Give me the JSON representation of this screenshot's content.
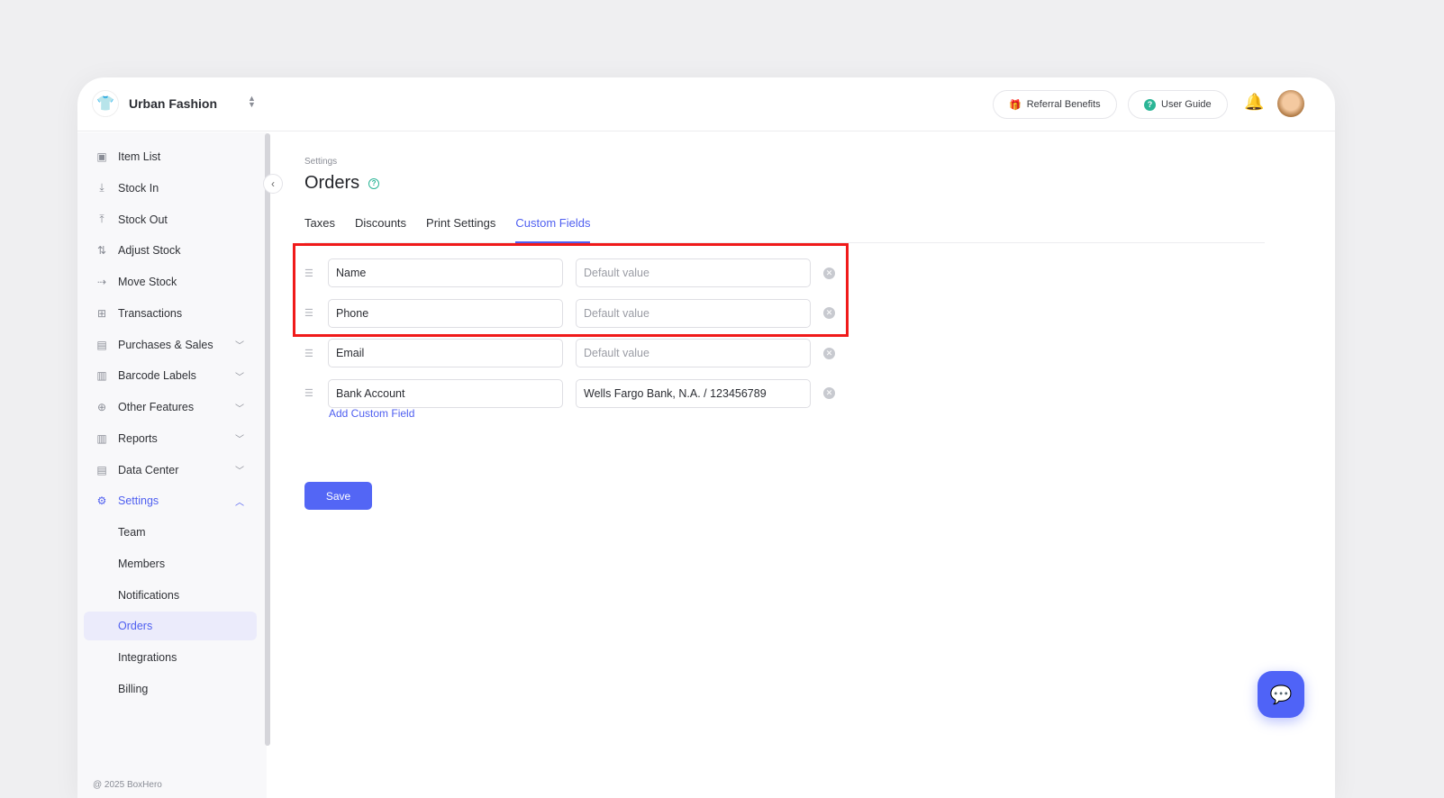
{
  "header": {
    "store_name": "Urban Fashion",
    "referral": "Referral Benefits",
    "user_guide": "User Guide"
  },
  "sidebar": {
    "items": [
      {
        "label": "Item List",
        "icon": "box-icon"
      },
      {
        "label": "Stock In",
        "icon": "arrow-down-icon"
      },
      {
        "label": "Stock Out",
        "icon": "arrow-up-icon"
      },
      {
        "label": "Adjust Stock",
        "icon": "arrows-updown-icon"
      },
      {
        "label": "Move Stock",
        "icon": "arrow-right-icon"
      },
      {
        "label": "Transactions",
        "icon": "transactions-icon"
      },
      {
        "label": "Purchases & Sales",
        "icon": "document-icon",
        "expandable": true
      },
      {
        "label": "Barcode Labels",
        "icon": "barcode-icon",
        "expandable": true
      },
      {
        "label": "Other Features",
        "icon": "plus-circle-icon",
        "expandable": true
      },
      {
        "label": "Reports",
        "icon": "chart-icon",
        "expandable": true
      },
      {
        "label": "Data Center",
        "icon": "database-icon",
        "expandable": true
      },
      {
        "label": "Settings",
        "icon": "gear-icon",
        "expandable": true,
        "open": true
      }
    ],
    "sub_items": [
      "Team",
      "Members",
      "Notifications",
      "Orders",
      "Integrations",
      "Billing"
    ],
    "active": "Orders",
    "footer": "@ 2025 BoxHero"
  },
  "main": {
    "breadcrumb": "Settings",
    "title": "Orders",
    "tabs": [
      "Taxes",
      "Discounts",
      "Print Settings",
      "Custom Fields"
    ],
    "active_tab": "Custom Fields",
    "fields": [
      {
        "name": "Name",
        "default": "",
        "placeholder": "Default value"
      },
      {
        "name": "Phone",
        "default": "",
        "placeholder": "Default value"
      },
      {
        "name": "Email",
        "default": "",
        "placeholder": "Default value"
      },
      {
        "name": "Bank Account",
        "default": "Wells Fargo Bank, N.A. / 123456789",
        "placeholder": "Default value"
      }
    ],
    "add_label": "Add Custom Field",
    "save_label": "Save"
  },
  "colors": {
    "accent": "#4f5ff0",
    "highlight": "#f01a1a",
    "help": "#2bb596"
  }
}
